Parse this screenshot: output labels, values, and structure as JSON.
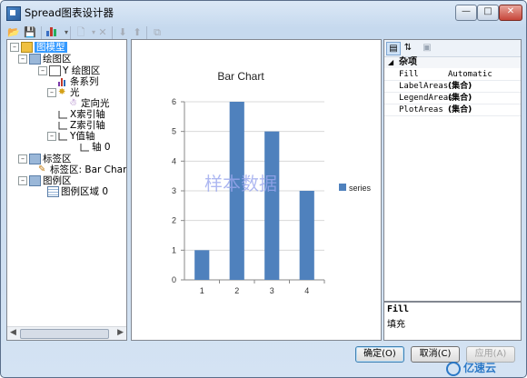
{
  "window": {
    "title": "Spread图表设计器"
  },
  "toolbar": {
    "icons": [
      "open-folder-icon",
      "save-icon",
      "chart-icon",
      "new-item-icon",
      "delete-icon",
      "move-down-icon",
      "move-up-icon",
      "copy-icon"
    ]
  },
  "tree": {
    "items": [
      {
        "label": "图模型"
      },
      {
        "label": "绘图区"
      },
      {
        "label": "Y 绘图区"
      },
      {
        "label": "条系列"
      },
      {
        "label": "光"
      },
      {
        "label": "定向光"
      },
      {
        "label": "X索引轴"
      },
      {
        "label": "Z索引轴"
      },
      {
        "label": "Y值轴"
      },
      {
        "label": "轴 0"
      },
      {
        "label": "标签区"
      },
      {
        "label": "标签区: Bar Chart"
      },
      {
        "label": "图例区"
      },
      {
        "label": "图例区域 0"
      }
    ]
  },
  "chart": {
    "watermark": "样本数据"
  },
  "chart_data": {
    "type": "bar",
    "title": "Bar Chart",
    "categories": [
      "1",
      "2",
      "3",
      "4"
    ],
    "series": [
      {
        "name": "series",
        "values": [
          1,
          6,
          5,
          3
        ]
      }
    ],
    "ylim": [
      0,
      6
    ],
    "yticks": [
      "0",
      "1",
      "2",
      "3",
      "4",
      "5",
      "6"
    ],
    "grid": true,
    "legend": "right",
    "color": "#4f81bd"
  },
  "properties": {
    "category": "杂项",
    "rows": [
      {
        "name": "Fill",
        "value": "Automatic"
      },
      {
        "name": "LabelAreas",
        "value": "(集合)"
      },
      {
        "name": "LegendAreas",
        "value": "(集合)"
      },
      {
        "name": "PlotAreas",
        "value": "(集合)"
      }
    ],
    "desc_title": "Fill",
    "desc_text": "填充"
  },
  "buttons": {
    "ok": "确定(O)",
    "cancel": "取消(C)",
    "apply": "应用(A)"
  },
  "logo": {
    "text": "亿速云"
  }
}
